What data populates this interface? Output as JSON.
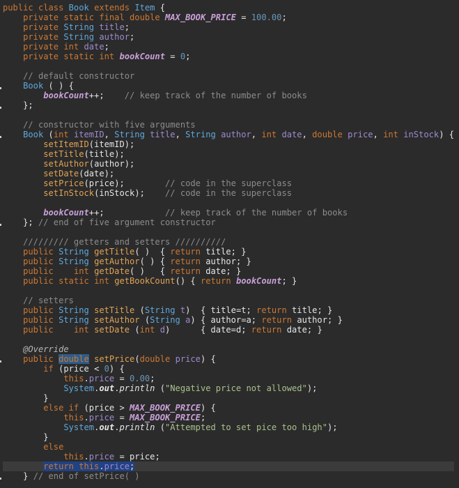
{
  "editor": {
    "language": "java",
    "file_content_note": "",
    "lines": [
      "public class Book extends Item {",
      "    private static final double MAX_BOOK_PRICE = 100.00;",
      "    private String title;",
      "    private String author;",
      "    private int date;",
      "    private static int bookCount = 0;",
      "",
      "    // default constructor",
      "    Book ( ) {",
      "        bookCount++;    // keep track of the number of books",
      "    };",
      "",
      "    // constructor with five arguments",
      "    Book (int itemID, String title, String author, int date, double price, int inStock) {",
      "        setItemID(itemID);",
      "        setTitle(title);",
      "        setAuthor(author);",
      "        setDate(date);",
      "        setPrice(price);        // code in the superclass",
      "        setInStock(inStock);    // code in the superclass",
      "",
      "        bookCount++;            // keep track of the number of books",
      "    }; // end of five argument constructor",
      "",
      "    ///////// getters and setters //////////",
      "    public String getTitle( )  { return title; }",
      "    public String getAuthor( ) { return author; }",
      "    public    int getDate( )   { return date; }",
      "    public static int getBookCount() { return bookCount; }",
      "",
      "    // setters",
      "    public String setTitle (String t)  { title=t; return title; }",
      "    public String setAuthor (String a) { author=a; return author; }",
      "    public    int setDate (int d)      { date=d; return date; }",
      "",
      "    @Override",
      "    public double setPrice(double price) {",
      "        if (price < 0) {",
      "            this.price = 0.00;",
      "            System.out.println (\"Negative price not allowed\");",
      "        }",
      "        else if (price > MAX_BOOK_PRICE) {",
      "            this.price = MAX_BOOK_PRICE;",
      "            System.out.println (\"Attempted to set pice too high\");",
      "        }",
      "        else",
      "            this.price = price;",
      "        return this.price;",
      "    } // end of setPrice( )"
    ],
    "current_line": 48,
    "colors": {
      "background": "#2b2b2b",
      "keyword": "#cc7832",
      "type": "#5fa8dc",
      "comment": "#8c8c8c",
      "string": "#a8c28c",
      "number": "#6897bb",
      "selection": "#214283"
    }
  }
}
